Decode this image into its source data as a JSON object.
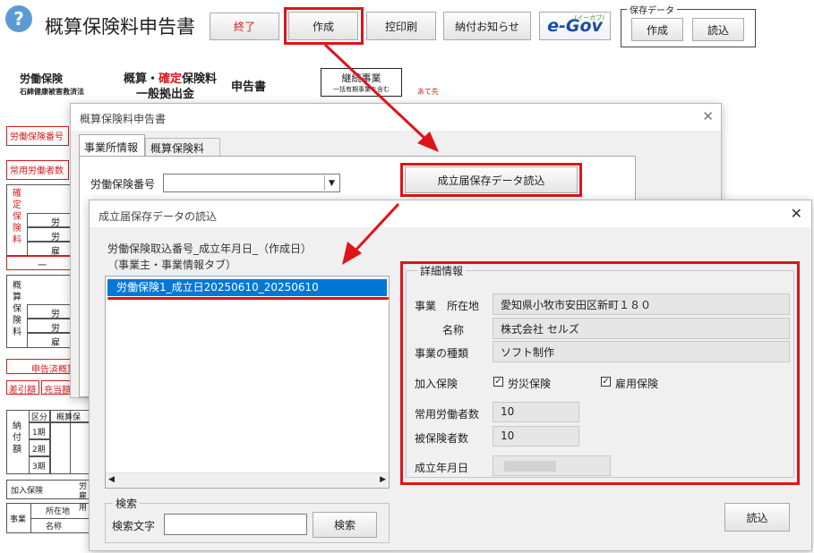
{
  "app": {
    "help_glyph": "?",
    "title": "概算保険料申告書",
    "toolbar": {
      "exit": "終了",
      "create": "作成",
      "print": "控印刷",
      "payment_notice": "納付お知らせ",
      "egov_logo": "e-Gov",
      "egov_small": "(イーガブ)",
      "saved_data_group": "保存データ",
      "saved_create": "作成",
      "saved_load": "読込"
    }
  },
  "background_form": {
    "heading1": "労働保険",
    "heading1_sub": "石綿健康被害救済法",
    "heading2_a": "概算・",
    "heading2_b": "確定",
    "heading2_c": "保険料",
    "heading3": "一般拠出金",
    "heading4": "申告書",
    "box_top": "継続事業",
    "box_sub": "一括有期事業を含む",
    "addressee": "あて先",
    "labels": {
      "insurance_no": "労働保険番号",
      "regular_workers": "常用労働者数",
      "confirmed_col": "確定保険料",
      "estimated_col": "概算保険料",
      "labor_short": "労",
      "employ_short": "雇",
      "ippan": "一",
      "declared": "申告済概算",
      "deduct": "差引額",
      "refund": "充当額",
      "payment_col": "納付額",
      "term": "区分",
      "term_col2": "概算保",
      "period1": "1期",
      "period2": "2期",
      "period3": "3期",
      "joined": "加入保険",
      "business": "事業",
      "address": "所在地",
      "name": "名称",
      "labor_s": "労",
      "employ_s": "雇用"
    }
  },
  "dialog_back": {
    "title": "概算保険料申告書",
    "tabs": [
      "事業所情報",
      "概算保険料"
    ],
    "insurance_no_label": "労働保険番号",
    "insurance_no_value": "",
    "load_button": "成立届保存データ読込"
  },
  "dialog_front": {
    "title": "成立届保存データの読込",
    "list_header_line1": "労働保険取込番号_成立年月日_（作成日）",
    "list_header_line2": "（事業主・事業情報タブ）",
    "list_items": [
      "労働保険1_成立日20250610_20250610"
    ],
    "search_group": "検索",
    "search_label": "検索文字",
    "search_placeholder": "",
    "search_button": "検索",
    "detail_group": "詳細情報",
    "detail": {
      "address_label": "事業　所在地",
      "address_value": "愛知県小牧市安田区新町１８０",
      "name_label": "名称",
      "name_value": "株式会社 セルズ",
      "type_label": "事業の種類",
      "type_value": "ソフト制作",
      "joined_label": "加入保険",
      "workers_comp": "労災保険",
      "employment": "雇用保険",
      "regular_workers_label": "常用労働者数",
      "regular_workers_value": "10",
      "insured_label": "被保険者数",
      "insured_value": "10",
      "established_label": "成立年月日",
      "established_value": ""
    },
    "load_button": "読込"
  },
  "colors": {
    "highlight": "#e0131a",
    "selection": "#0078d7",
    "egov_blue": "#1a4ca8",
    "egov_green": "#3aa535"
  }
}
